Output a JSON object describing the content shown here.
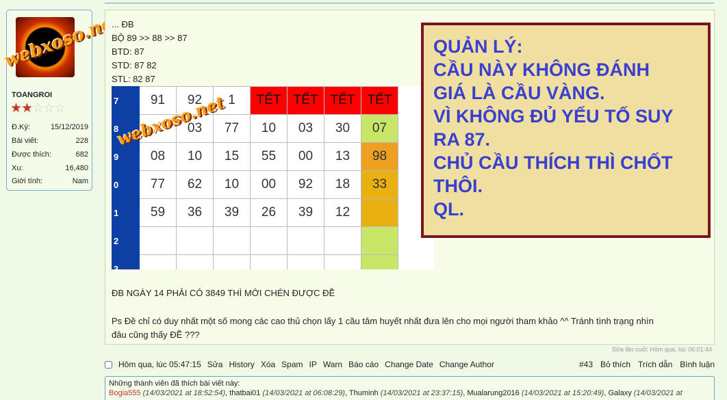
{
  "user": {
    "name": "TOANGROI",
    "stars_on": "★★",
    "stars_off": "☆☆☆",
    "stats": [
      {
        "label": "Đ.Ký:",
        "value": "15/12/2019"
      },
      {
        "label": "Bài viết:",
        "value": "228"
      },
      {
        "label": "Được thích:",
        "value": "682"
      },
      {
        "label": "Xu:",
        "value": "16,480"
      },
      {
        "label": "Giới tính:",
        "value": "Nam"
      }
    ]
  },
  "watermark": "webxoso.net",
  "post": {
    "lines": [
      "... ĐB",
      "BỘ 89 >> 88 >> 87",
      "BTD: 87",
      "STD: 87 82",
      "STL: 82 87"
    ],
    "table": {
      "rows": [
        {
          "label": "7",
          "cells": [
            "91",
            "92",
            "1",
            "TẾT",
            "TẾT",
            "TẾT",
            "TẾT"
          ]
        },
        {
          "label": "8",
          "cells": [
            "",
            "03",
            "77",
            "10",
            "03",
            "30",
            "07"
          ]
        },
        {
          "label": "9",
          "cells": [
            "08",
            "10",
            "15",
            "55",
            "00",
            "13",
            "98"
          ]
        },
        {
          "label": "0",
          "cells": [
            "77",
            "62",
            "10",
            "00",
            "92",
            "18",
            "33"
          ]
        },
        {
          "label": "1",
          "cells": [
            "59",
            "36",
            "39",
            "26",
            "39",
            "12",
            ""
          ]
        },
        {
          "label": "2",
          "cells": [
            "",
            "",
            "",
            "",
            "",
            "",
            ""
          ]
        },
        {
          "label": "3",
          "cells": [
            "",
            "",
            "",
            "",
            "",
            "",
            ""
          ]
        }
      ]
    },
    "notice": [
      "QUẢN LÝ:",
      "CẦU NÀY KHÔNG ĐÁNH",
      "GIÁ LÀ CẦU VÀNG.",
      "VÌ KHÔNG ĐỦ YẾU TỐ SUY",
      "RA 87.",
      "CHỦ CẦU THÍCH THÌ CHỐT",
      "THÔI.",
      "QL."
    ],
    "db_line": "ĐB NGÀY 14 PHẢI CÓ 3849 THÌ MỚI CHÉN ĐƯỢC ĐỀ",
    "ps_line1": "Ps Đề chỉ có duy nhất một số mong các cao thủ chọn lấy 1 cầu tâm huyết nhất đưa lên cho mọi người tham khảo ^^ Tránh tình trạng nhìn",
    "ps_line2": "đâu cũng thấy ĐỀ ???",
    "edited": "Sửa lần cuối: Hôm qua, lúc 06:01:44"
  },
  "actions": {
    "time": "Hôm qua, lúc 05:47:15",
    "left": [
      "Sửa",
      "History",
      "Xóa",
      "Spam",
      "IP",
      "Warn",
      "Báo cáo",
      "Change Date",
      "Change Author"
    ],
    "post_no": "#43",
    "right": [
      "Bỏ thích",
      "Trích dẫn",
      "Bình luận"
    ]
  },
  "likes": {
    "title": "Những thành viên đã thích bài viết này:",
    "first_user": "Bogia555",
    "entries": [
      {
        "u": "",
        "t": "(14/03/2021 at 18:52:54)"
      },
      {
        "u": ", thatbai01 ",
        "t": "(14/03/2021 at 06:08:29)"
      },
      {
        "u": ", Thuminh ",
        "t": "(14/03/2021 at 23:37:15)"
      },
      {
        "u": ", Mualarung2016 ",
        "t": "(14/03/2021 at 15:20:49)"
      },
      {
        "u": ", Galaxy ",
        "t": "(14/03/2021 at"
      }
    ]
  }
}
